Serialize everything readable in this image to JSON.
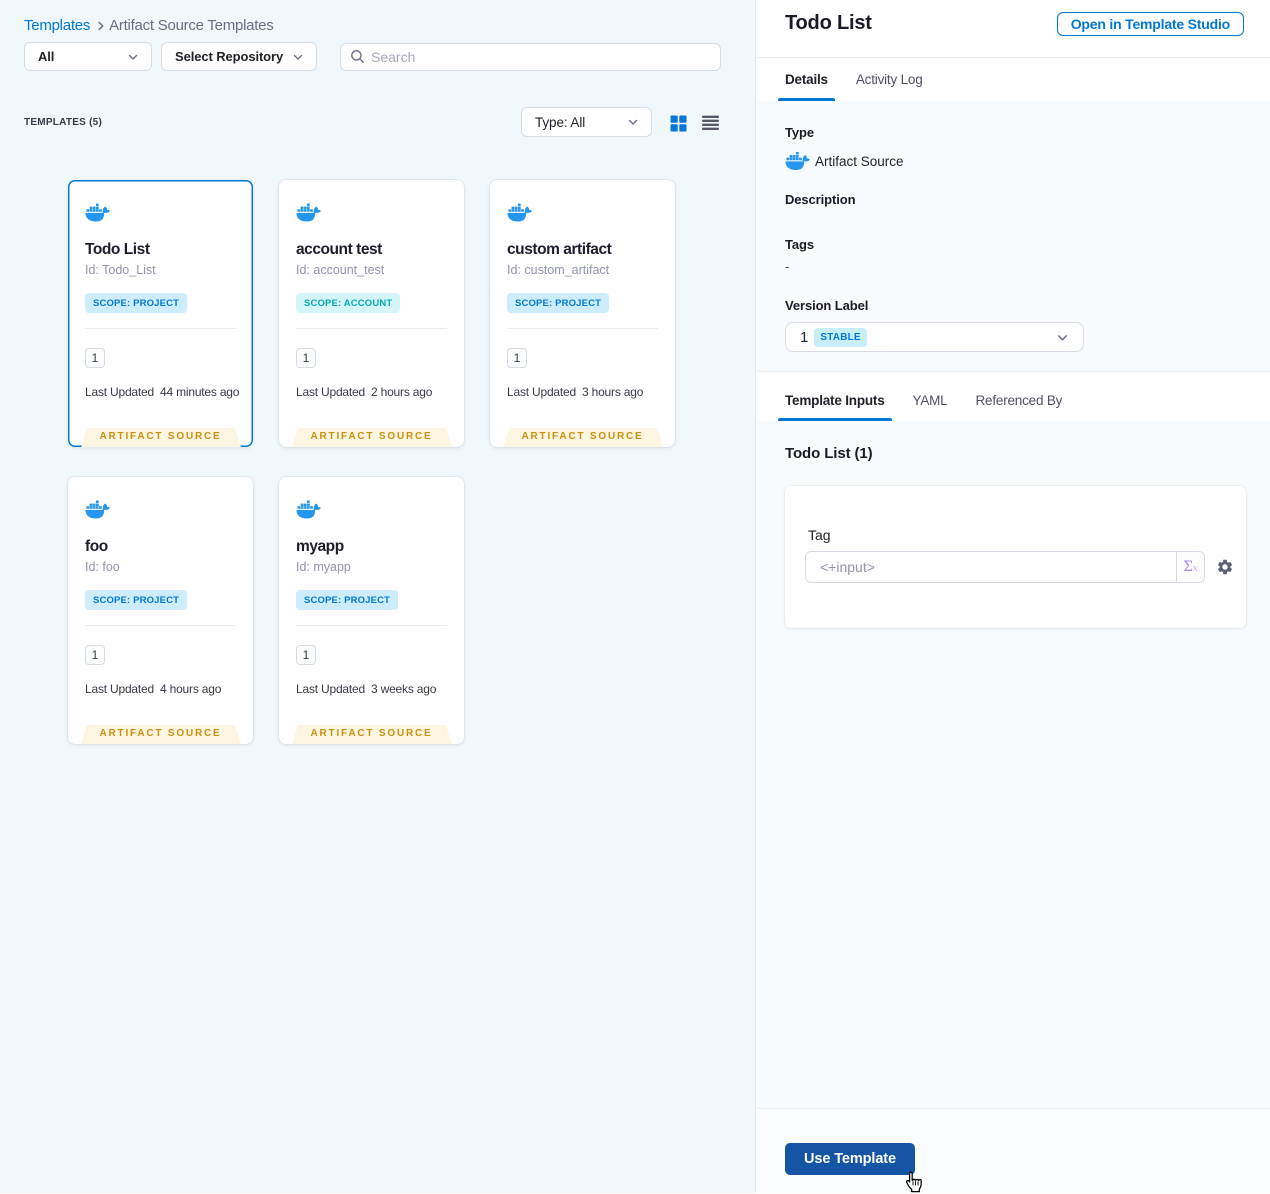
{
  "breadcrumb": {
    "root": "Templates",
    "current": "Artifact Source Templates"
  },
  "filters": {
    "scope_dropdown": "All",
    "repository_dropdown": "Select Repository",
    "search_placeholder": "Search"
  },
  "list_header": {
    "count_label": "TEMPLATES (5)",
    "type_filter": "Type: All"
  },
  "cards": [
    {
      "title": "Todo List",
      "id": "Id: Todo_List",
      "scope": "SCOPE: PROJECT",
      "version_count": "1",
      "last_updated_label": "Last Updated",
      "last_updated_value": "44 minutes ago",
      "footer_tag": "ARTIFACT SOURCE"
    },
    {
      "title": "account test",
      "id": "Id: account_test",
      "scope": "SCOPE: ACCOUNT",
      "version_count": "1",
      "last_updated_label": "Last Updated",
      "last_updated_value": "2 hours ago",
      "footer_tag": "ARTIFACT SOURCE"
    },
    {
      "title": "custom artifact",
      "id": "Id: custom_artifact",
      "scope": "SCOPE: PROJECT",
      "version_count": "1",
      "last_updated_label": "Last Updated",
      "last_updated_value": "3 hours ago",
      "footer_tag": "ARTIFACT SOURCE"
    },
    {
      "title": "foo",
      "id": "Id: foo",
      "scope": "SCOPE: PROJECT",
      "version_count": "1",
      "last_updated_label": "Last Updated",
      "last_updated_value": "4 hours ago",
      "footer_tag": "ARTIFACT SOURCE"
    },
    {
      "title": "myapp",
      "id": "Id: myapp",
      "scope": "SCOPE: PROJECT",
      "version_count": "1",
      "last_updated_label": "Last Updated",
      "last_updated_value": "3 weeks ago",
      "footer_tag": "ARTIFACT SOURCE"
    }
  ],
  "details_panel": {
    "title": "Todo List",
    "open_studio_button": "Open in Template Studio",
    "tabs": {
      "details": "Details",
      "activity_log": "Activity Log"
    },
    "type_label": "Type",
    "type_value": "Artifact Source",
    "description_label": "Description",
    "tags_label": "Tags",
    "tags_value": "-",
    "version_label": "Version Label",
    "version_value": "1",
    "version_badge": "STABLE",
    "inputs_tabs": {
      "template_inputs": "Template Inputs",
      "yaml": "YAML",
      "referenced_by": "Referenced By"
    },
    "inputs_title": "Todo List (1)",
    "tag_field_label": "Tag",
    "tag_field_value": "<+input>",
    "use_template_button": "Use Template"
  },
  "colors": {
    "primary": "#0278D5",
    "docker_blue": "#2496ED",
    "ribbon_text": "#C7910E",
    "ribbon_bg": "#FCF5E2",
    "use_template_bg": "#1455A5"
  }
}
